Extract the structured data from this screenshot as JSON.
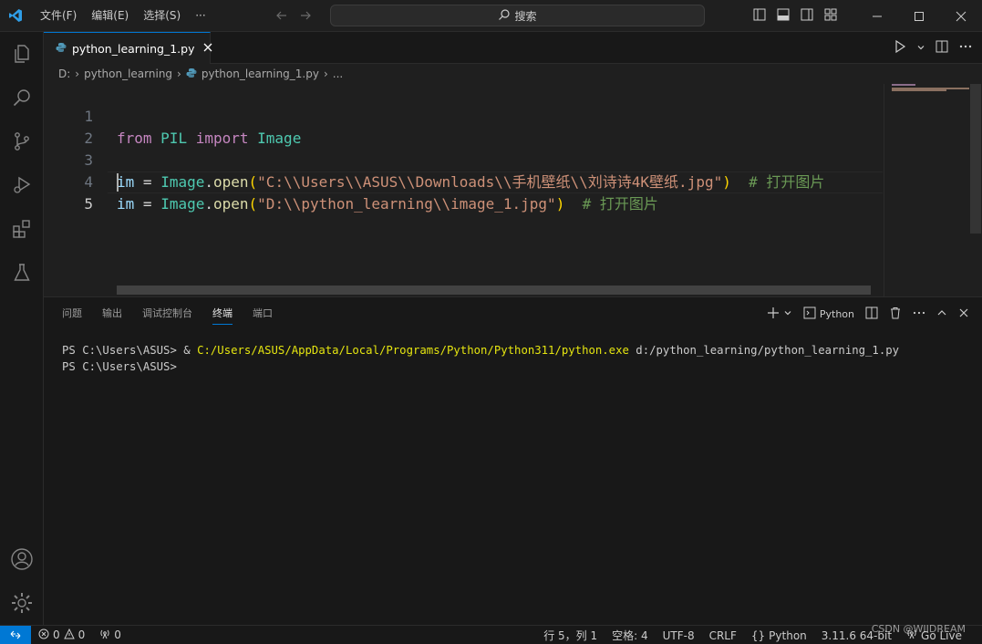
{
  "titlebar": {
    "menus": [
      "文件(F)",
      "编辑(E)",
      "选择(S)",
      "···"
    ],
    "search_label": "搜索"
  },
  "tab": {
    "label": "python_learning_1.py"
  },
  "breadcrumb": {
    "drive": "D:",
    "folder": "python_learning",
    "file": "python_learning_1.py",
    "more": "..."
  },
  "editor": {
    "line_numbers": [
      "1",
      "2",
      "3",
      "4",
      "5"
    ],
    "line1": {
      "kw1": "from",
      "mod": "PIL",
      "kw2": "import",
      "cls": "Image"
    },
    "line3": {
      "var": "im",
      "eq": "=",
      "cls": "Image",
      "dot": ".",
      "fn": "open",
      "lp": "(",
      "str": "\"C:\\\\Users\\\\ASUS\\\\Downloads\\\\手机壁纸\\\\刘诗诗4K壁纸.jpg\"",
      "rp": ")",
      "cmt": "# 打开图片"
    },
    "line4": {
      "var": "im",
      "eq": "=",
      "cls": "Image",
      "dot": ".",
      "fn": "open",
      "lp": "(",
      "str": "\"D:\\\\python_learning\\\\image_1.jpg\"",
      "rp": ")",
      "cmt": "# 打开图片"
    }
  },
  "panel": {
    "tabs": [
      "问题",
      "输出",
      "调试控制台",
      "终端",
      "端口"
    ],
    "active_tab": "终端",
    "terminal_profile": "Python",
    "terminal_lines": {
      "l1_prompt": "PS C:\\Users\\ASUS> & ",
      "l1_exe": "C:/Users/ASUS/AppData/Local/Programs/Python/Python311/python.exe",
      "l1_arg": " d:/python_learning/python_learning_1.py",
      "l2_prompt": "PS C:\\Users\\ASUS>"
    }
  },
  "statusbar": {
    "errors": "0",
    "warnings": "0",
    "ports": "0",
    "position": "行 5，列 1",
    "spaces": "空格: 4",
    "encoding": "UTF-8",
    "eol": "CRLF",
    "language": "Python",
    "interpreter": "3.11.6 64-bit",
    "golive": "Go Live"
  },
  "watermark": "CSDN @WIIDREAM",
  "colors": {
    "accent": "#0078d4",
    "keyword": "#c586c0",
    "class": "#4ec9b0",
    "string": "#ce9178",
    "comment": "#6a9955"
  }
}
